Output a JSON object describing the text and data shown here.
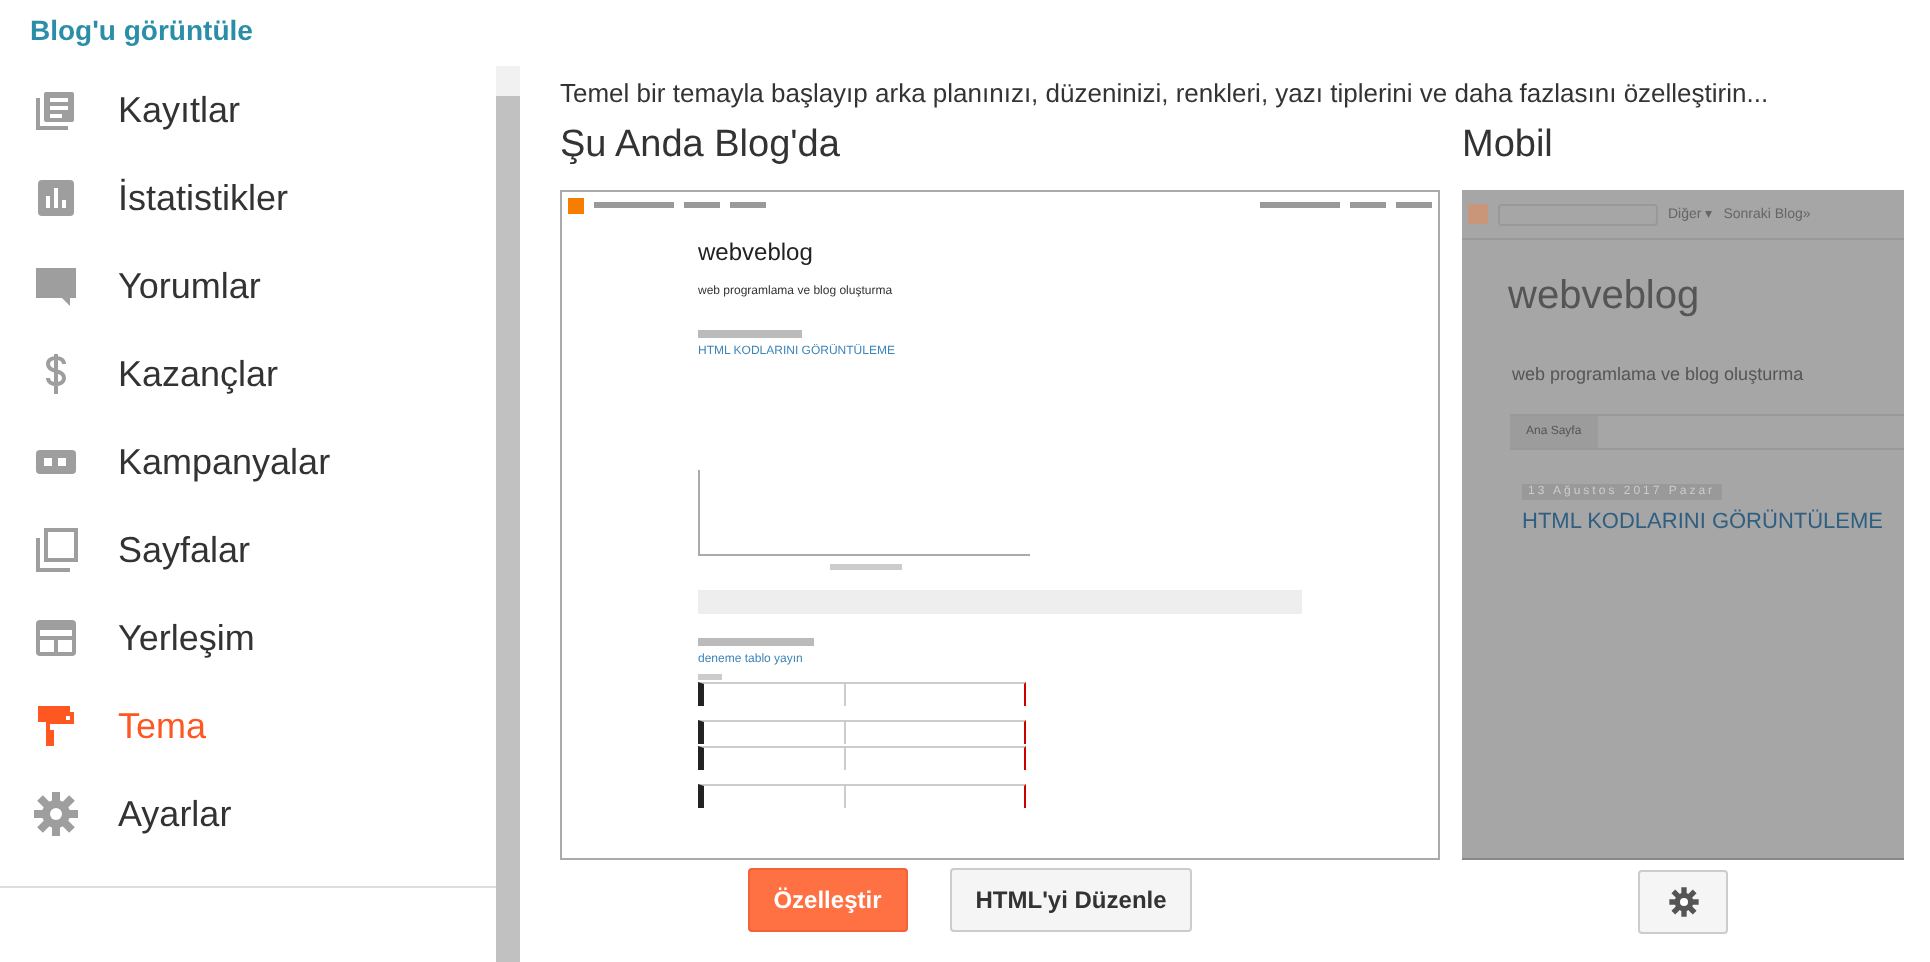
{
  "sidebar": {
    "view_link": "Blog'u görüntüle",
    "items": [
      {
        "label": "Kayıtlar",
        "selected": false
      },
      {
        "label": "İstatistikler",
        "selected": false
      },
      {
        "label": "Yorumlar",
        "selected": false
      },
      {
        "label": "Kazançlar",
        "selected": false
      },
      {
        "label": "Kampanyalar",
        "selected": false
      },
      {
        "label": "Sayfalar",
        "selected": false
      },
      {
        "label": "Yerleşim",
        "selected": false
      },
      {
        "label": "Tema",
        "selected": true
      },
      {
        "label": "Ayarlar",
        "selected": false
      }
    ]
  },
  "description": "Temel bir temayla başlayıp arka planınızı, düzeninizi, renkleri, yazı tiplerini ve daha fazlasını özelleştirin...",
  "desktop": {
    "title": "Şu Anda Blog'da",
    "preview": {
      "blog_title": "webveblog",
      "tagline": "web programlama ve blog oluşturma",
      "post_title": "HTML KODLARINI GÖRÜNTÜLEME",
      "post_title_2": "deneme tablo yayın"
    },
    "buttons": [
      {
        "label": "Özelleştir",
        "kind": "primary"
      },
      {
        "label": "HTML'yi Düzenle",
        "kind": "secondary"
      }
    ]
  },
  "mobile": {
    "title": "Mobil",
    "preview": {
      "nav": [
        "Diğer ▾",
        "Sonraki Blog»"
      ],
      "blog_title": "webveblog",
      "tagline": "web programlama ve blog oluşturma",
      "tab": "Ana Sayfa",
      "date": "13 Ağustos 2017 Pazar",
      "post_title": "HTML KODLARINI GÖRÜNTÜLEME"
    }
  }
}
